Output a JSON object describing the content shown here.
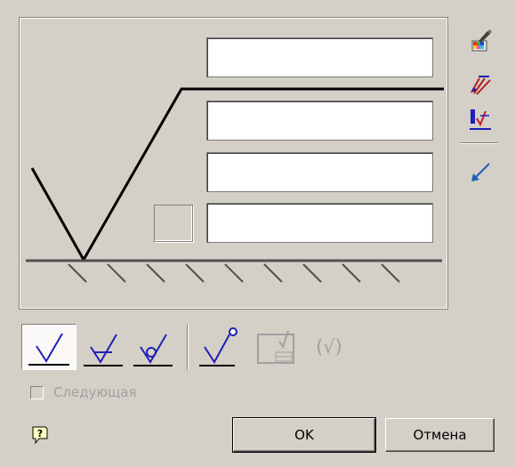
{
  "fields": [
    {
      "value": "",
      "placeholder": ""
    },
    {
      "value": "",
      "placeholder": ""
    },
    {
      "value": "",
      "placeholder": ""
    },
    {
      "value": "",
      "placeholder": ""
    }
  ],
  "side_tools": [
    "color-brush-icon",
    "arrows-icon",
    "roughness-settings-icon",
    "leader-arrow-icon"
  ],
  "symbol_types": [
    "basic-check-symbol-icon",
    "removal-symbol-icon",
    "no-removal-symbol-icon",
    "all-around-symbol-icon",
    "table-symbol-icon"
  ],
  "symbol_paren": "(√)",
  "next_checkbox": {
    "label": "Следующая",
    "checked": false,
    "enabled": false
  },
  "buttons": {
    "ok": "OK",
    "cancel": "Отмена"
  },
  "colors": {
    "accent_blue": "#1f1fb8",
    "disabled_gray": "#a0a0a0",
    "dialog_bg": "#d4d0c8"
  }
}
